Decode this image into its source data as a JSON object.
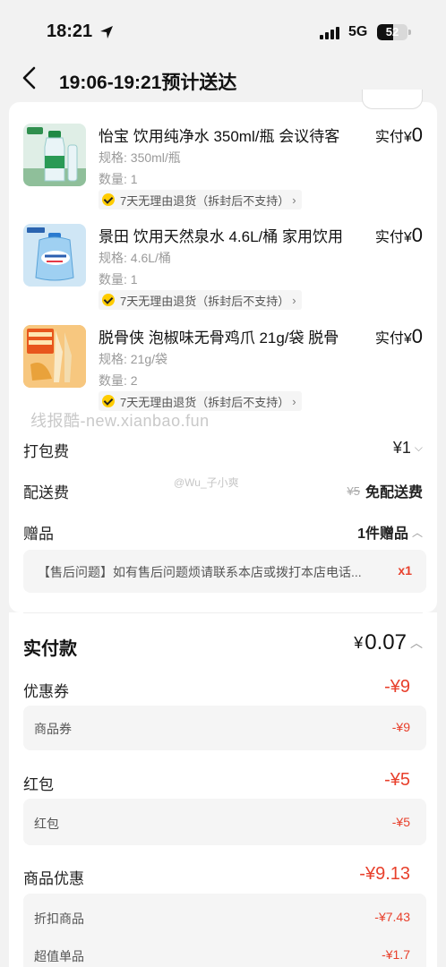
{
  "status_bar": {
    "time": "18:21",
    "network": "5G",
    "battery": "52",
    "battery_level": 0.52
  },
  "header": {
    "title": "19:06-19:21预计送达"
  },
  "products": [
    {
      "title": "怡宝 饮用纯净水 350ml/瓶 会议待客",
      "price_prefix": "实付¥",
      "price": "0",
      "spec": "规格: 350ml/瓶",
      "qty": "数量: 1",
      "return_policy": "7天无理由退货（拆封后不支持）",
      "thumb_icon": "water-bottle-icon"
    },
    {
      "title": "景田 饮用天然泉水 4.6L/桶 家用饮用",
      "price_prefix": "实付¥",
      "price": "0",
      "spec": "规格: 4.6L/桶",
      "qty": "数量: 1",
      "return_policy": "7天无理由退货（拆封后不支持）",
      "thumb_icon": "water-barrel-icon"
    },
    {
      "title": "脱骨侠 泡椒味无骨鸡爪 21g/袋  脱骨",
      "price_prefix": "实付¥",
      "price": "0",
      "spec": "规格: 21g/袋",
      "qty": "数量: 2",
      "return_policy": "7天无理由退货（拆封后不支持）",
      "thumb_icon": "snack-bag-icon"
    }
  ],
  "watermark": "线报酷-new.xianbao.fun",
  "weibo_mark": "@Wu_子小爽",
  "fees": {
    "packing_label": "打包费",
    "packing_value": "¥1",
    "delivery_label": "配送费",
    "delivery_original": "¥5",
    "delivery_value": "免配送费",
    "gift_label": "赠品",
    "gift_value": "1件赠品"
  },
  "gift_item": {
    "text": "【售后问题】如有售后问题烦请联系本店或拨打本店电话...",
    "qty": "x1"
  },
  "payment": {
    "label": "实付款",
    "currency": "¥",
    "amount": "0.07"
  },
  "discounts": {
    "coupon_label": "优惠券",
    "coupon_value": "-¥9",
    "coupon_sub_label": "商品券",
    "coupon_sub_value": "-¥9",
    "redpacket_label": "红包",
    "redpacket_value": "-¥5",
    "redpacket_sub_label": "红包",
    "redpacket_sub_value": "-¥5",
    "product_label": "商品优惠",
    "product_value": "-¥9.13",
    "product_sub1_label": "折扣商品",
    "product_sub1_value": "-¥7.43",
    "product_sub2_label": "超值单品",
    "product_sub2_value": "-¥1.7"
  },
  "colors": {
    "accent_red": "#e8402c",
    "check_yellow": "#ffcc00"
  }
}
